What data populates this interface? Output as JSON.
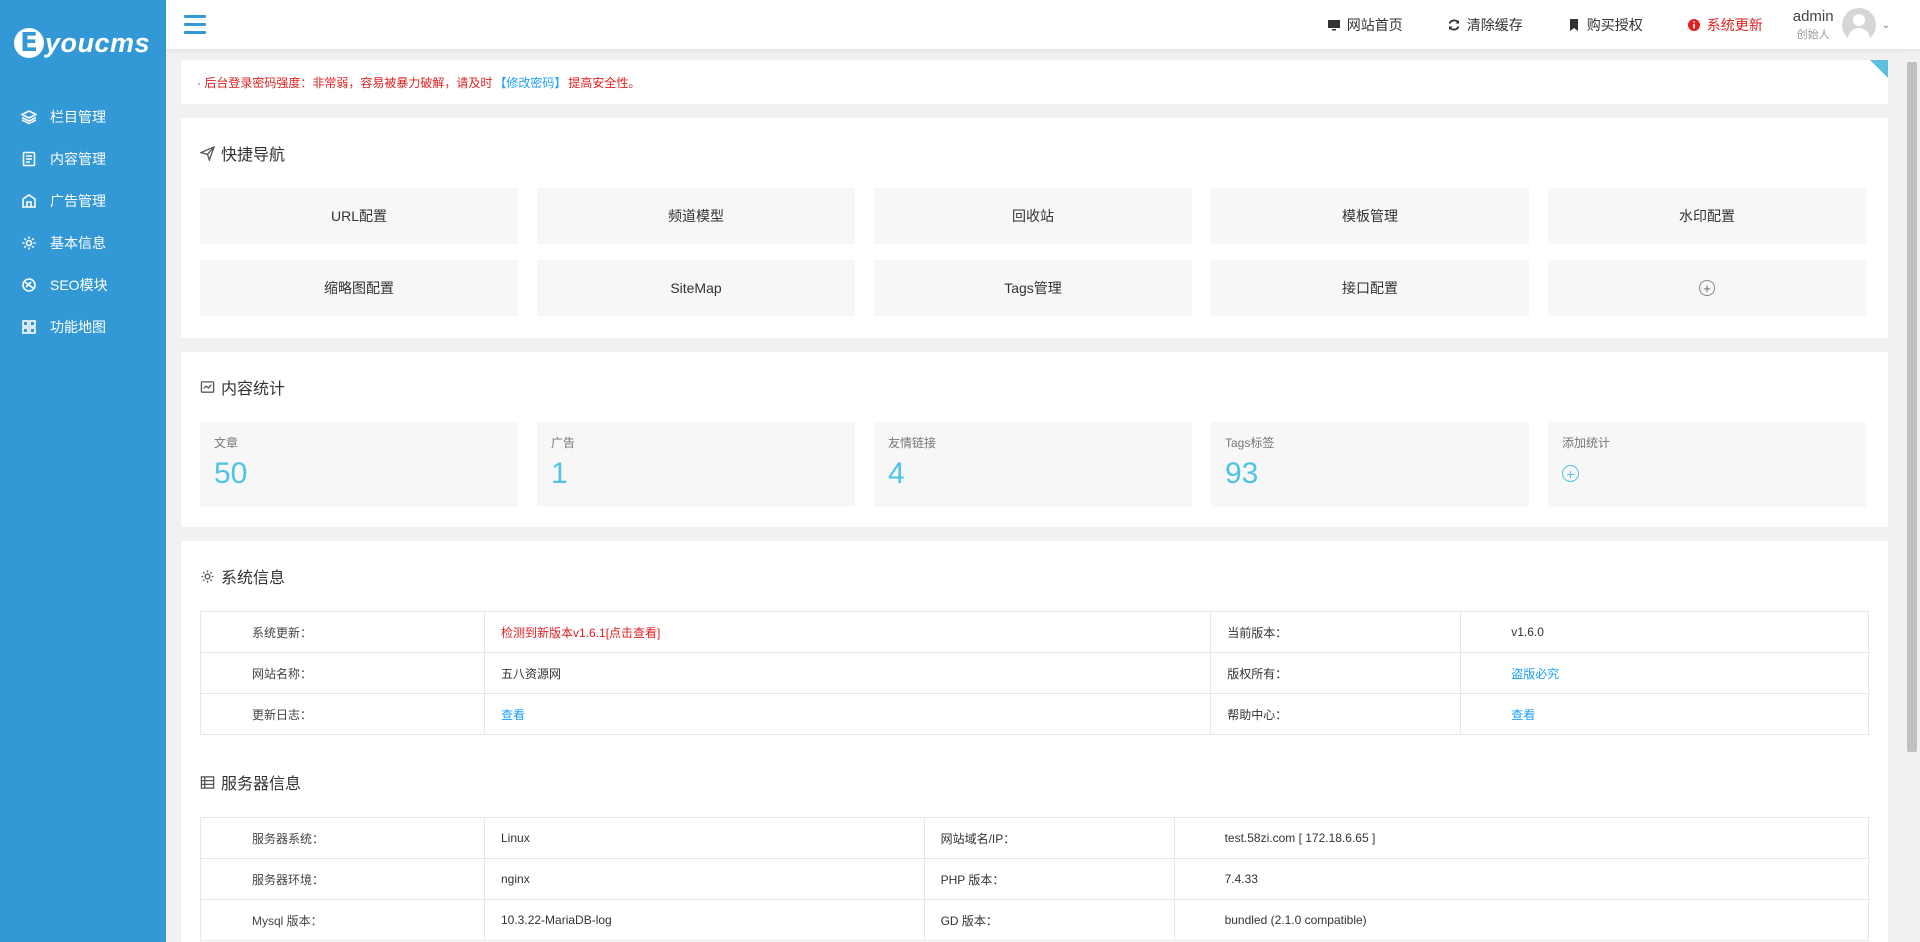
{
  "brand": {
    "badge": "E",
    "name": "youcms"
  },
  "sidebar": {
    "items": [
      {
        "label": "栏目管理",
        "icon": "layers-icon"
      },
      {
        "label": "内容管理",
        "icon": "document-icon"
      },
      {
        "label": "广告管理",
        "icon": "ad-icon"
      },
      {
        "label": "基本信息",
        "icon": "gear-icon"
      },
      {
        "label": "SEO模块",
        "icon": "seo-icon"
      },
      {
        "label": "功能地图",
        "icon": "grid-icon"
      }
    ]
  },
  "topbar": {
    "links": [
      {
        "label": "网站首页",
        "icon": "monitor-icon"
      },
      {
        "label": "清除缓存",
        "icon": "refresh-icon"
      },
      {
        "label": "购买授权",
        "icon": "bookmark-icon"
      },
      {
        "label": "系统更新",
        "icon": "info-icon"
      }
    ],
    "user": {
      "name": "admin",
      "role": "创始人"
    }
  },
  "alert": {
    "prefix": "· 后台登录密码强度：非常弱，容易被暴力破解，请及时",
    "link": "【修改密码】",
    "suffix": "提高安全性。"
  },
  "quick_nav": {
    "title": "快捷导航",
    "items": [
      "URL配置",
      "频道模型",
      "回收站",
      "模板管理",
      "水印配置",
      "缩略图配置",
      "SiteMap",
      "Tags管理",
      "接口配置"
    ],
    "add": "+"
  },
  "content_stats": {
    "title": "内容统计",
    "items": [
      {
        "label": "文章",
        "value": "50"
      },
      {
        "label": "广告",
        "value": "1"
      },
      {
        "label": "友情链接",
        "value": "4"
      },
      {
        "label": "Tags标签",
        "value": "93"
      }
    ],
    "add_label": "添加统计",
    "add": "+"
  },
  "system_info": {
    "title": "系统信息",
    "rows": [
      [
        "系统更新：",
        "检测到新版本v1.6.1[点击查看]",
        "当前版本：",
        "v1.6.0"
      ],
      [
        "网站名称：",
        "五八资源网",
        "版权所有：",
        "盗版必究"
      ],
      [
        "更新日志：",
        "查看",
        "帮助中心：",
        "查看"
      ]
    ]
  },
  "server_info": {
    "title": "服务器信息",
    "rows": [
      [
        "服务器系统：",
        "Linux",
        "网站域名/IP：",
        "test.58zi.com [ 172.18.6.65 ]"
      ],
      [
        "服务器环境：",
        "nginx",
        "PHP 版本：",
        "7.4.33"
      ],
      [
        "Mysql 版本：",
        "10.3.22-MariaDB-log",
        "GD 版本：",
        "bundled (2.1.0 compatible)"
      ]
    ]
  },
  "colors": {
    "sidebar": "#3399d6",
    "accent": "#4ec3e6",
    "link": "#1e9fff",
    "alert": "#e02020"
  }
}
